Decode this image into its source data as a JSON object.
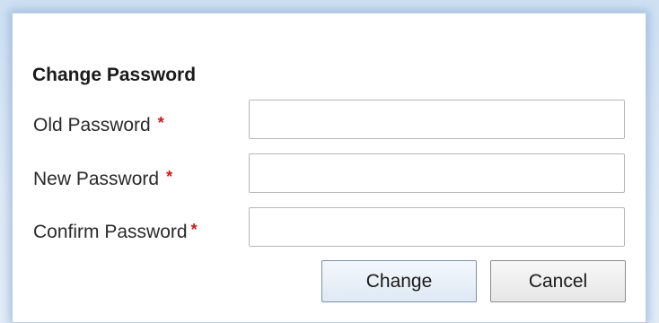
{
  "dialog": {
    "title": "Change Password",
    "fields": [
      {
        "label": "Old Password",
        "required_mark": "*",
        "value": ""
      },
      {
        "label": "New Password",
        "required_mark": "*",
        "value": ""
      },
      {
        "label": "Confirm Password",
        "required_mark": "*",
        "value": ""
      }
    ],
    "buttons": {
      "change_label": "Change",
      "cancel_label": "Cancel"
    }
  },
  "colors": {
    "required": "#d01818",
    "dialog_glow": "#78a0d2",
    "border": "#b7b7b7"
  }
}
